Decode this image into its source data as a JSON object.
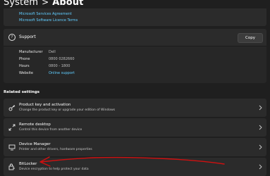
{
  "header": {
    "parent": "System",
    "separator": ">",
    "current": "About"
  },
  "links": [
    "Microsoft Services Agreement",
    "Microsoft Software Licence Terms"
  ],
  "support": {
    "title": "Support",
    "copy_label": "Copy",
    "fields": [
      {
        "label": "Manufacturer",
        "value": "Dell"
      },
      {
        "label": "Phone",
        "value": "0800 0282660"
      },
      {
        "label": "Hours",
        "value": "0800 - 1800"
      },
      {
        "label": "Website",
        "value": "Online support"
      }
    ]
  },
  "related": {
    "title": "Related settings",
    "items": [
      {
        "title": "Product key and activation",
        "subtitle": "Change the product key or upgrade your edition of Windows",
        "icon": "key-icon"
      },
      {
        "title": "Remote desktop",
        "subtitle": "Control this device from another device",
        "icon": "remote-desktop-icon"
      },
      {
        "title": "Device Manager",
        "subtitle": "Printer and other drivers, hardware properties",
        "icon": "device-manager-icon"
      },
      {
        "title": "BitLocker",
        "subtitle": "Device encryption to help protect your data",
        "icon": "bitlocker-icon"
      }
    ]
  },
  "colors": {
    "background": "#1f1f1f",
    "card": "#2b2b2b",
    "link": "#60cdff",
    "annotation": "#d01010"
  }
}
